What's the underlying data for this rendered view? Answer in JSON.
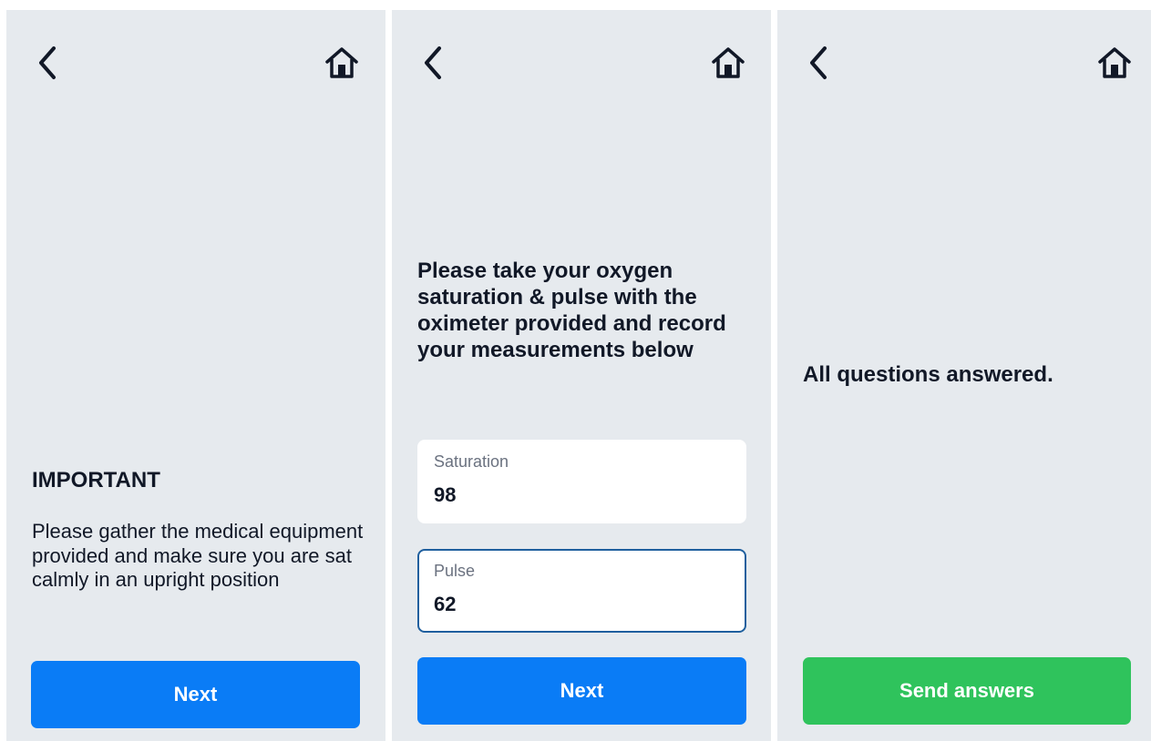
{
  "screens": [
    {
      "back_icon": "chevron-left-icon",
      "home_icon": "home-icon",
      "title": "IMPORTANT",
      "body": "Please gather the medical equipment provided and make sure you are sat calmly in an upright position",
      "button_label": "Next"
    },
    {
      "back_icon": "chevron-left-icon",
      "home_icon": "home-icon",
      "title": "Please take your oxygen saturation & pulse with the oximeter provided and record your measurements below",
      "fields": [
        {
          "label": "Saturation",
          "value": "98"
        },
        {
          "label": "Pulse",
          "value": "62"
        }
      ],
      "button_label": "Next"
    },
    {
      "back_icon": "chevron-left-icon",
      "home_icon": "home-icon",
      "title": "All questions answered.",
      "button_label": "Send answers"
    }
  ],
  "colors": {
    "background": "#e6eaee",
    "primary_button": "#0a7cf6",
    "success_button": "#2fc35c",
    "focus_border": "#1f5f9e"
  }
}
